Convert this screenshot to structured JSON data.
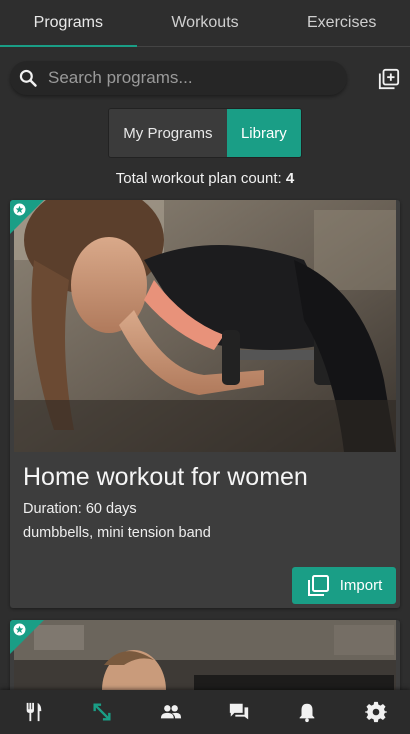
{
  "tabs": [
    {
      "label": "Programs",
      "active": true
    },
    {
      "label": "Workouts",
      "active": false
    },
    {
      "label": "Exercises",
      "active": false
    }
  ],
  "search": {
    "placeholder": "Search programs...",
    "value": ""
  },
  "segmented": {
    "my_programs": "My Programs",
    "library": "Library",
    "selected": "Library"
  },
  "count": {
    "label": "Total workout plan count:",
    "value": "4"
  },
  "cards": [
    {
      "title": "Home workout for women",
      "duration": "Duration: 60 days",
      "equipment": "dumbbells, mini tension band",
      "button": "Import"
    }
  ],
  "colors": {
    "accent": "#1a9e86",
    "background": "#2e2e2e",
    "card": "#3d3d3d"
  },
  "bottom_nav": [
    {
      "icon": "utensils-icon",
      "active": false
    },
    {
      "icon": "arrows-expand-icon",
      "active": true
    },
    {
      "icon": "people-icon",
      "active": false
    },
    {
      "icon": "chat-icon",
      "active": false
    },
    {
      "icon": "bell-icon",
      "active": false
    },
    {
      "icon": "gear-icon",
      "active": false
    }
  ]
}
